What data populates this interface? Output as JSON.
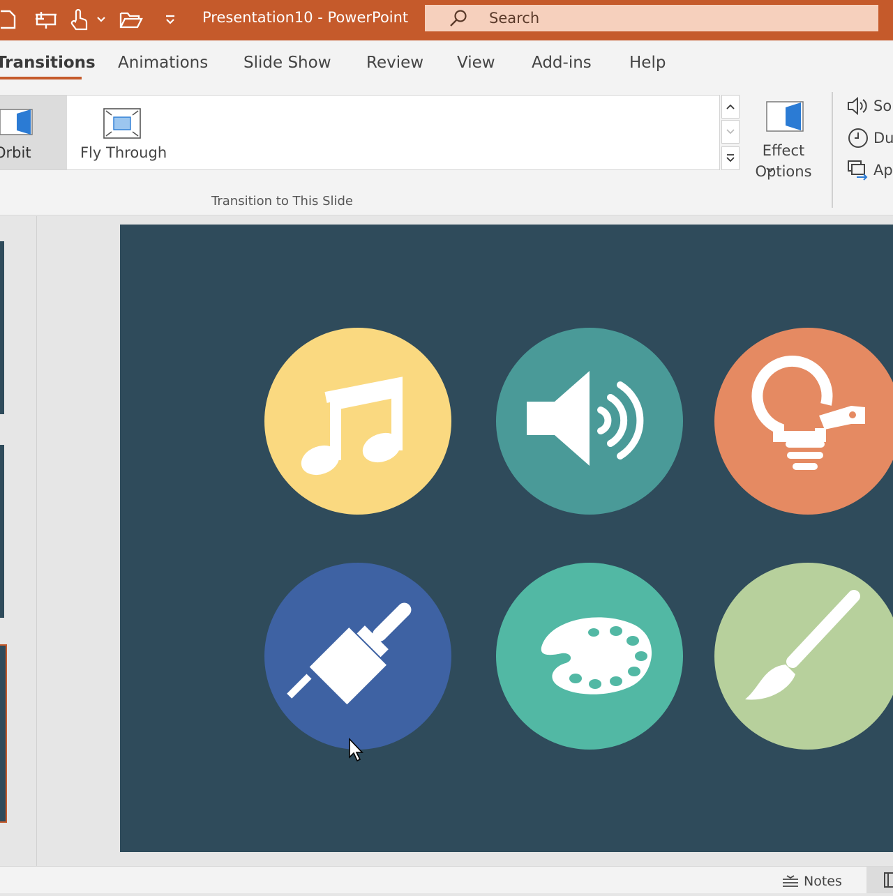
{
  "window": {
    "title": "Presentation10  -  PowerPoint",
    "search_placeholder": "Search"
  },
  "quick_access": [
    "new-file-icon",
    "present-icon",
    "touch-mode-icon",
    "dropdown-icon",
    "open-folder-icon",
    "customize-icon"
  ],
  "tabs": [
    {
      "label": "Transitions",
      "active": true
    },
    {
      "label": "Animations"
    },
    {
      "label": "Slide Show"
    },
    {
      "label": "Review"
    },
    {
      "label": "View"
    },
    {
      "label": "Add-ins"
    },
    {
      "label": "Help"
    }
  ],
  "ribbon": {
    "gallery": [
      {
        "label": "Orbit",
        "selected": true
      },
      {
        "label": "Fly Through"
      }
    ],
    "group_label": "Transition to This Slide",
    "effect_options": {
      "line1": "Effect",
      "line2": "Options"
    },
    "timing": [
      {
        "label": "So",
        "icon": "sound-icon"
      },
      {
        "label": "Du",
        "icon": "clock-icon"
      },
      {
        "label": "Ap",
        "icon": "apply-all-icon"
      }
    ]
  },
  "slide": {
    "background": "#2f4b5b",
    "icons": [
      {
        "name": "music-note-icon",
        "color": "#fad980"
      },
      {
        "name": "speaker-icon",
        "color": "#4a9a98"
      },
      {
        "name": "lightbulb-icon",
        "color": "#e58a62"
      },
      {
        "name": "paint-brush-icon",
        "color": "#3e62a3"
      },
      {
        "name": "palette-icon",
        "color": "#52b8a4"
      },
      {
        "name": "art-brush-icon",
        "color": "#b7d09c"
      }
    ]
  },
  "statusbar": {
    "notes_label": "Notes"
  },
  "colors": {
    "accent": "#c55a2b",
    "search_bg": "#f6d0bd"
  }
}
